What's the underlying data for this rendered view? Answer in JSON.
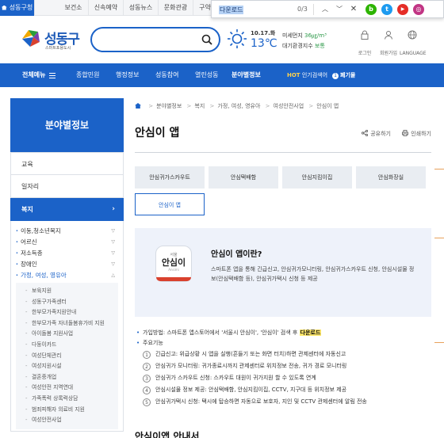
{
  "topbar": {
    "tabs": [
      "성동구청",
      "보건소",
      "신속예약",
      "성동뉴스",
      "문화관광",
      "구약"
    ]
  },
  "findbar": {
    "query": "다운로드",
    "count": "0/3",
    "up_icon": "chevron-up-icon",
    "down_icon": "chevron-down-icon",
    "close_icon": "close-icon",
    "social": [
      {
        "name": "blog",
        "label": "b",
        "color": "#2db400"
      },
      {
        "name": "twitter",
        "label": "t",
        "color": "#1d9bf0"
      },
      {
        "name": "youtube",
        "label": "▶",
        "color": "#e52d27"
      },
      {
        "name": "instagram",
        "label": "◎",
        "color": "#c13584"
      }
    ]
  },
  "header": {
    "logo_name": "성동구",
    "logo_slogan": "스마트포용도시",
    "search_placeholder": "",
    "weather": {
      "date": "10.17.화",
      "temp": "13℃",
      "dust_label": "미세먼지",
      "dust_value": "36㎍/m³",
      "air_label": "대기환경지수",
      "air_value": "보통"
    },
    "utils": [
      {
        "label": "로그인",
        "icon": "lock-icon"
      },
      {
        "label": "회원가입",
        "icon": "user-icon"
      },
      {
        "label": "LANGUAGE",
        "icon": "globe-icon"
      }
    ]
  },
  "gnb": {
    "all_menu": "전체메뉴",
    "menus": [
      "종합민원",
      "행정정보",
      "성동참여",
      "열린성동",
      "분야별정보"
    ],
    "current": "분야별정보",
    "hot_label": "HOT",
    "hot_text": "인기검색어",
    "hot_rank": "1",
    "hot_keyword": "폐기물"
  },
  "lnb": {
    "title": "분야별정보",
    "items": [
      "교육",
      "일자리",
      "복지"
    ],
    "active": "복지",
    "sub": [
      {
        "label": "이동,청소년복지",
        "open": false
      },
      {
        "label": "어르신",
        "open": false
      },
      {
        "label": "저소득층",
        "open": false
      },
      {
        "label": "장애인",
        "open": false
      },
      {
        "label": "가정, 여성, 영유아",
        "open": true
      }
    ],
    "sub3": [
      "보육지원",
      "성동구가족센터",
      "한부모가족지원안내",
      "한부모가족 자녀돌봄휴가비 지원",
      "아이돌봄 지원사업",
      "다둥이카드",
      "여성단체관리",
      "여성지원시설",
      "결혼중개업",
      "여성안전 지역연대",
      "가족폭력 상록력상담",
      "범죄피해자 의료비 지원",
      "여성안전사업"
    ]
  },
  "content": {
    "breadcrumb": [
      "분야별정보",
      "복지",
      "가정, 여성, 영유아",
      "여성안전사업",
      "안심이 앱"
    ],
    "title": "안심이 앱",
    "share": "공유하기",
    "print": "인쇄하기",
    "tabs": [
      "안심귀가스카우트",
      "안심택배함",
      "안심지킴이집",
      "안심화장실",
      "안심이 앱"
    ],
    "active_tab": "안심이 앱",
    "app_icon": {
      "small": "서울",
      "big": "안심이",
      "en": "Ansimi"
    },
    "intro_q": "안심이 앱이란?",
    "intro_desc": "스마트폰 앱을 통해 긴급신고, 안심귀가모니터링, 안심귀가스카우트 신청, 안심시설물 정보(안심택배함 등), 안심귀가택시 신청 등 제공",
    "usage_prefix": "가입방법: 스마트폰 앱스토어에서 '서울시 안심이', '안심이' 검색 후 ",
    "usage_highlight": "다운로드",
    "features_label": "주요기능",
    "features": [
      "긴급신고: 위급상황 시 앱을 실행(흔들기 또는 화면 터치)하면 관제센터에 자동신고",
      "안심귀가 모니터링: 귀가종료시까지 관제센터로 위치정보 전송, 귀가 경로 모니터링",
      "안심귀가 스카우트 신청: 스카우트 대원이 귀가지원 할 수 있도록 연계",
      "안심시설물 정보 제공: 안심택배함, 안심지킴이집, CCTV, 지구대 등 위치정보 제공",
      "안심귀가택시 신청: 택시에 탑승하면 자동으로 보호자, 지인 및 CCTV 관제센터에 알림 전송"
    ],
    "next_heading": "안심이앱 안내서"
  },
  "colors": {
    "primary": "#1b62c8",
    "highlight": "#ffe86b",
    "intro_bg": "#eef2fa"
  }
}
